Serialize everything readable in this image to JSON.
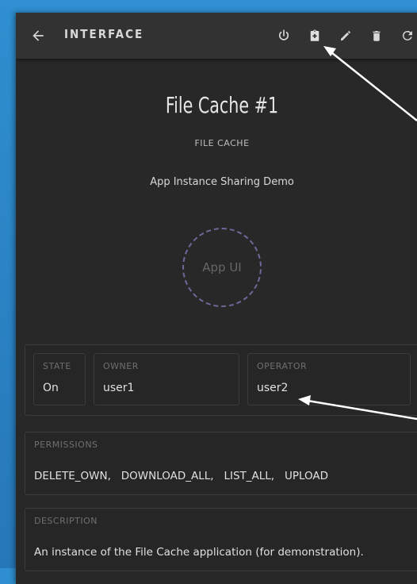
{
  "toolbar": {
    "title": "INTERFACE",
    "back_icon": "arrow-left-icon",
    "icons": [
      "power-icon",
      "clipboard-icon",
      "pencil-icon",
      "trash-icon",
      "refresh-icon"
    ]
  },
  "main": {
    "title": "File Cache #1",
    "subtitle": "FILE CACHE",
    "description": "App Instance Sharing Demo",
    "app_ui_label": "App UI"
  },
  "fields": {
    "state": {
      "label": "STATE",
      "value": "On"
    },
    "owner": {
      "label": "OWNER",
      "value": "user1"
    },
    "operator": {
      "label": "OPERATOR",
      "value": "user2"
    }
  },
  "permissions": {
    "label": "PERMISSIONS",
    "value": "DELETE_OWN,   DOWNLOAD_ALL,   LIST_ALL,   UPLOAD"
  },
  "description_card": {
    "label": "DESCRIPTION",
    "value": "An instance of the File Cache application (for demonstration)."
  },
  "colors": {
    "background": "#2b84c6",
    "panel": "#282828",
    "toolbar": "#323232",
    "dashed_circle": "#6b6a9a",
    "annotation_arrow": "#ffffff"
  }
}
